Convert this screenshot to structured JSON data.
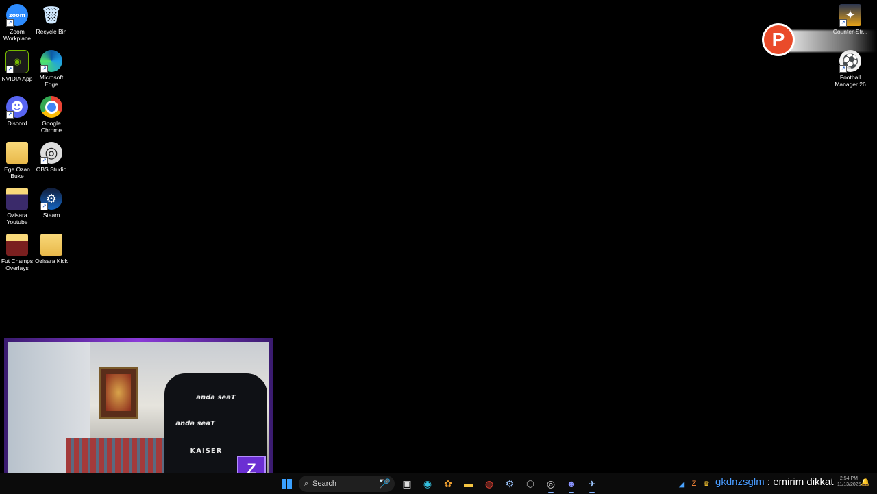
{
  "desktop_icons": [
    {
      "name": "Zoom Workplace",
      "glyph": "zoom",
      "icon": "zoom-icon"
    },
    {
      "name": "Recycle Bin",
      "glyph": "🗑",
      "icon": "recycle-bin-icon"
    },
    {
      "name": "NVIDIA App",
      "glyph": "◉",
      "icon": "nvidia-icon"
    },
    {
      "name": "Microsoft Edge",
      "glyph": "",
      "icon": "edge-icon"
    },
    {
      "name": "Discord",
      "glyph": "☻",
      "icon": "discord-icon"
    },
    {
      "name": "Google Chrome",
      "glyph": "",
      "icon": "chrome-icon"
    },
    {
      "name": "Ege Ozan Buke",
      "glyph": "",
      "icon": "folder-icon"
    },
    {
      "name": "OBS Studio",
      "glyph": "◎",
      "icon": "obs-icon"
    },
    {
      "name": "Ozisara Youtube",
      "glyph": "",
      "icon": "folder-icon"
    },
    {
      "name": "Steam",
      "glyph": "⚙",
      "icon": "steam-icon"
    },
    {
      "name": "Fut Champs Overlays",
      "glyph": "",
      "icon": "folder-icon"
    },
    {
      "name": "Ozisara Kick",
      "glyph": "",
      "icon": "folder-icon"
    },
    {
      "name": "Counter-Str...",
      "glyph": "✦",
      "icon": "counter-strike-icon"
    },
    {
      "name": "Football Manager 26",
      "glyph": "⚽",
      "icon": "football-manager-icon"
    }
  ],
  "overlay_badge": "P",
  "webcam": {
    "chair_brand": "anda seaT",
    "chair_brand_2": "anda seaT",
    "chair_model": "KAISER",
    "corner_logo": "Z"
  },
  "taskbar": {
    "search_placeholder": "Search"
  },
  "chat": {
    "user": "gkdnzsglm",
    "separator": " : ",
    "message": "emirim dikkat"
  },
  "clock": {
    "time": "2:54 PM",
    "date": "11/13/2025"
  },
  "colors": {
    "chat_user": "#4a9cff",
    "webcam_border": "#8a3ad8",
    "badge": "#ea4b2a"
  }
}
